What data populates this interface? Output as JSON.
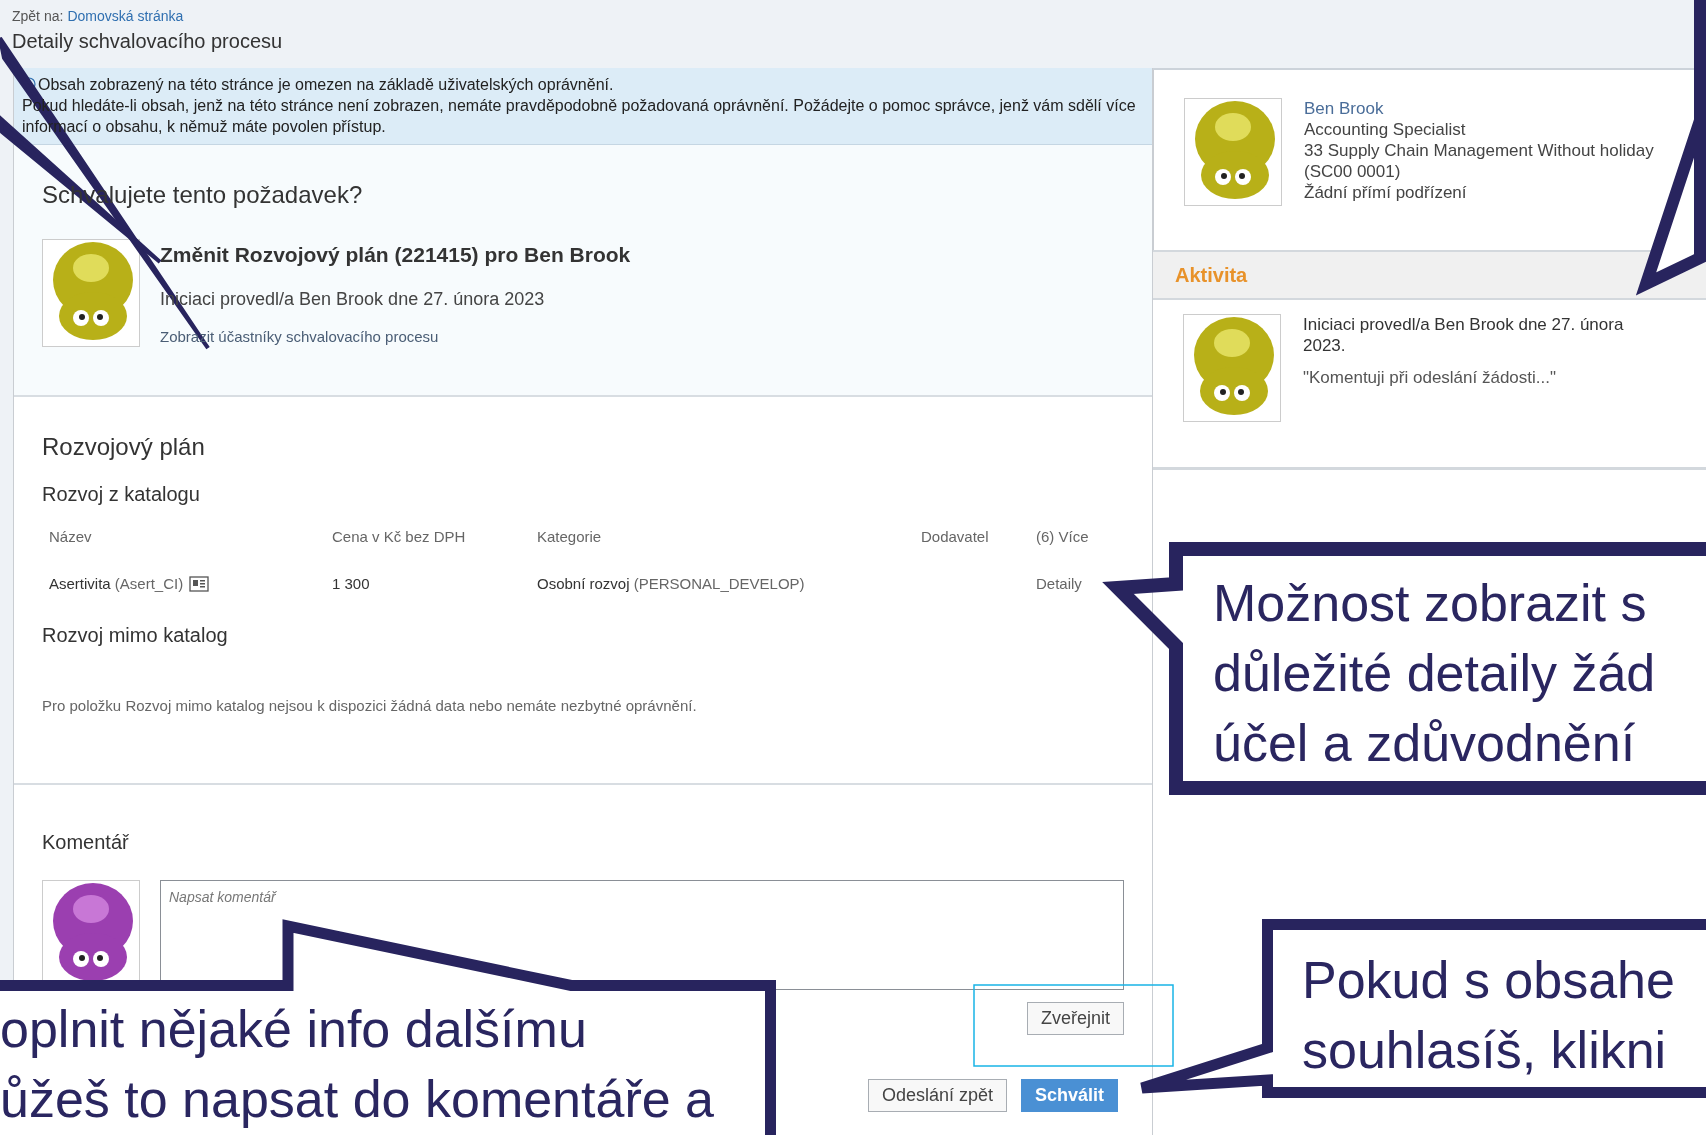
{
  "header": {
    "back_label": "Zpět na:",
    "back_link": "Domovská stránka",
    "title": "Detaily schvalovacího procesu"
  },
  "notice": {
    "lines": [
      "Obsah zobrazený na této stránce je omezen na základě uživatelských oprávnění.",
      "Pokud hledáte-li obsah, jenž na této stránce není zobrazen, nemáte pravděpodobně požadovaná oprávnění. Požádejte o pomoc správce, jenž vám sdělí více informací o obsahu, k němuž máte povolen přístup."
    ]
  },
  "request": {
    "question": "Schvalujete tento požadavek?",
    "title": "Změnit Rozvojový plán (221415) pro Ben Brook",
    "initiated": "Iniciaci provedl/a Ben Brook dne 27. února 2023",
    "participants_link": "Zobrazit účastníky schvalovacího procesu"
  },
  "plan": {
    "heading": "Rozvojový plán",
    "catalog_heading": "Rozvoj z katalogu",
    "columns": [
      "Název",
      "Cena v Kč bez DPH",
      "Kategorie",
      "Dodavatel",
      "(6) Více"
    ],
    "rows": [
      {
        "name": "Asertivita",
        "code": "(Asert_CI)",
        "price": "1 300",
        "category": "Osobní rozvoj",
        "category_code": "(PERSONAL_DEVELOP)",
        "more": "Detaily"
      }
    ],
    "offcatalog_heading": "Rozvoj mimo katalog",
    "offcatalog_note": "Pro položku Rozvoj mimo katalog nejsou k dispozici žádná data nebo nemáte nezbytné oprávnění."
  },
  "comment": {
    "heading": "Komentář",
    "placeholder": "Napsat komentář",
    "post_button": "Zveřejnit"
  },
  "actions": [
    {
      "label": "Odeslání zpět",
      "primary": false
    },
    {
      "label": "Schválit",
      "primary": true
    }
  ],
  "profile": {
    "name": "Ben Brook",
    "lines": [
      "Accounting Specialist",
      "33 Supply Chain Management Without holiday",
      "(SC00 0001)",
      "Žádní přímí podřízení"
    ]
  },
  "activity": {
    "heading": "Aktivita",
    "entries": [
      {
        "text": "Iniciaci provedl/a Ben Brook dne 27. února 2023.",
        "comment": "\"Komentuji při odeslání žádosti...\""
      }
    ]
  },
  "annotations": [
    {
      "kind": "right",
      "lines": [
        "Možnost zobrazit s",
        "důležité detaily žád",
        "účel a zdůvodnění"
      ]
    },
    {
      "kind": "bottom-left",
      "lines": [
        "oplnit nějaké info dalšímu",
        "ůžeš to napsat do komentáře a"
      ]
    },
    {
      "kind": "bottom-right",
      "lines": [
        "Pokud s obsahe",
        "souhlasíš, klikni"
      ]
    }
  ]
}
